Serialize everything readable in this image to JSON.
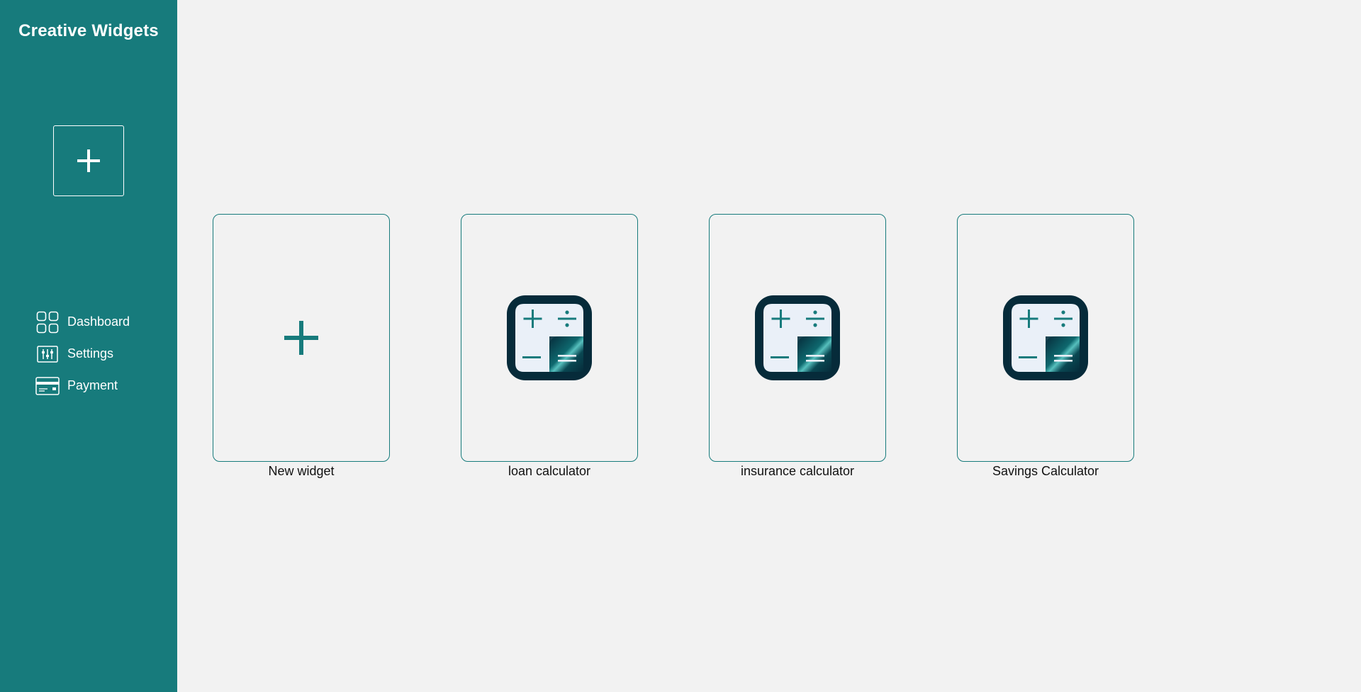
{
  "app": {
    "title": "Creative Widgets"
  },
  "sidebar": {
    "add_button_icon": "plus-icon",
    "items": [
      {
        "label": "Dashboard",
        "icon": "dashboard-icon"
      },
      {
        "label": "Settings",
        "icon": "sliders-icon"
      },
      {
        "label": "Payment",
        "icon": "credit-card-icon"
      }
    ]
  },
  "widgets": [
    {
      "label": "New widget",
      "icon": "plus-icon"
    },
    {
      "label": "loan calculator",
      "icon": "calculator-icon"
    },
    {
      "label": "insurance calculator",
      "icon": "calculator-icon"
    },
    {
      "label": "Savings Calculator",
      "icon": "calculator-icon"
    }
  ],
  "colors": {
    "primary": "#177b7c",
    "background": "#f2f2f2",
    "calculator_dark": "#062b3a",
    "calculator_light": "#eaf0f8"
  }
}
